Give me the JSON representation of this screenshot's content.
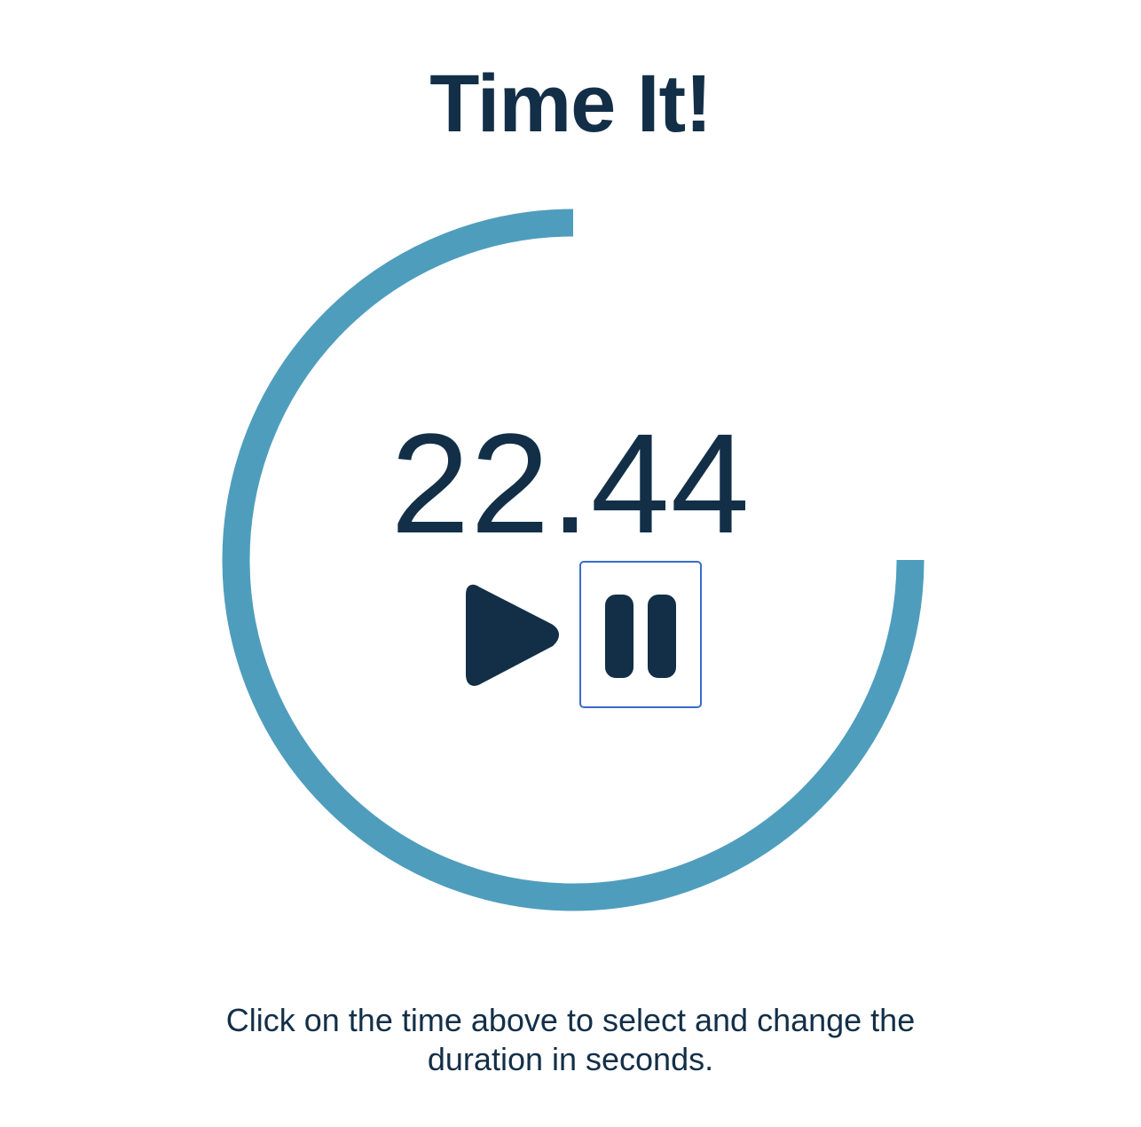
{
  "page": {
    "title": "Time It!"
  },
  "timer": {
    "display_value": "22.44",
    "progress_fraction": 0.75,
    "ring_color": "#4f9dbd",
    "text_color": "#132f48",
    "focus_outline_color": "#3a6cc9"
  },
  "controls": {
    "play_icon": "play-icon",
    "pause_icon": "pause-icon",
    "focused": "pause-button"
  },
  "instructions": {
    "text": "Click on the time above to select and change the duration in seconds."
  }
}
